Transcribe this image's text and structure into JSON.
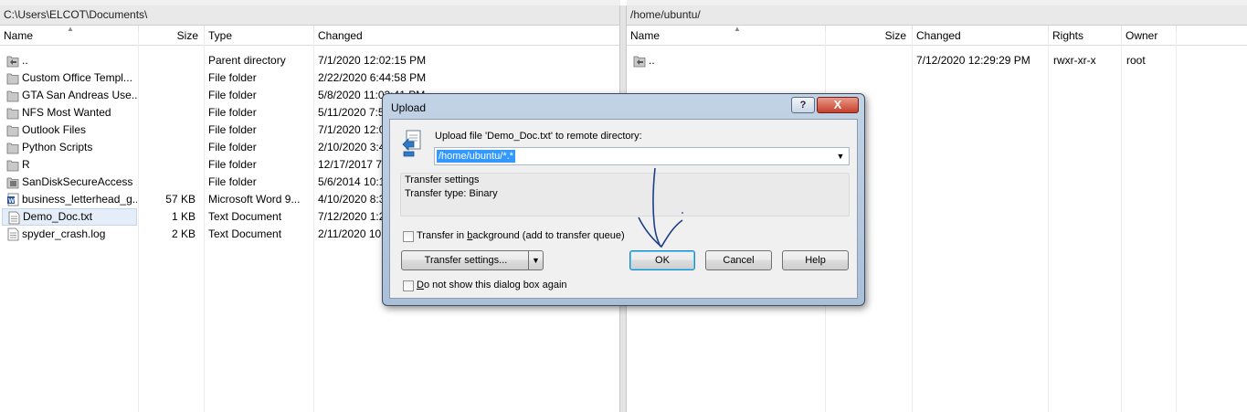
{
  "left_panel": {
    "path": "C:\\Users\\ELCOT\\Documents\\",
    "columns": {
      "name": "Name",
      "size": "Size",
      "type": "Type",
      "changed": "Changed"
    },
    "rows": [
      {
        "name": "..",
        "size": "",
        "type": "Parent directory",
        "changed": "7/1/2020  12:02:15 PM",
        "icon": "parent-folder-icon"
      },
      {
        "name": "Custom Office Templ...",
        "size": "",
        "type": "File folder",
        "changed": "2/22/2020  6:44:58 PM",
        "icon": "folder-icon"
      },
      {
        "name": "GTA San Andreas Use...",
        "size": "",
        "type": "File folder",
        "changed": "5/8/2020  11:03:41 PM",
        "icon": "folder-icon"
      },
      {
        "name": "NFS Most Wanted",
        "size": "",
        "type": "File folder",
        "changed": "5/11/2020  7:5",
        "icon": "folder-icon"
      },
      {
        "name": "Outlook Files",
        "size": "",
        "type": "File folder",
        "changed": "7/1/2020  12:0",
        "icon": "folder-icon"
      },
      {
        "name": "Python Scripts",
        "size": "",
        "type": "File folder",
        "changed": "2/10/2020  3:4",
        "icon": "folder-icon"
      },
      {
        "name": "R",
        "size": "",
        "type": "File folder",
        "changed": "12/17/2017  7",
        "icon": "folder-icon"
      },
      {
        "name": "SanDiskSecureAccess ...",
        "size": "",
        "type": "File folder",
        "changed": "5/6/2014  10:1",
        "icon": "sandisk-folder-icon"
      },
      {
        "name": "business_letterhead_g...",
        "size": "57 KB",
        "type": "Microsoft Word 9...",
        "changed": "4/10/2020  8:3",
        "icon": "word-document-icon"
      },
      {
        "name": "Demo_Doc.txt",
        "size": "1 KB",
        "type": "Text Document",
        "changed": "7/12/2020  1:2",
        "icon": "text-file-icon",
        "selected": true
      },
      {
        "name": "spyder_crash.log",
        "size": "2 KB",
        "type": "Text Document",
        "changed": "2/11/2020  10:",
        "icon": "text-file-icon"
      }
    ]
  },
  "right_panel": {
    "path": "/home/ubuntu/",
    "columns": {
      "name": "Name",
      "size": "Size",
      "changed": "Changed",
      "rights": "Rights",
      "owner": "Owner"
    },
    "rows": [
      {
        "name": "..",
        "size": "",
        "changed": "7/12/2020  12:29:29 PM",
        "rights": "rwxr-xr-x",
        "owner": "root",
        "icon": "parent-folder-icon"
      }
    ]
  },
  "dialog": {
    "title": "Upload",
    "help_glyph": "?",
    "close_glyph": "X",
    "prompt": "Upload file 'Demo_Doc.txt' to remote directory:",
    "target_value": "/home/ubuntu/*.*",
    "group_title": "Transfer settings",
    "transfer_type": "Transfer type: Binary",
    "background_prefix": "Transfer in ",
    "background_hotkey": "b",
    "background_suffix": "ackground (add to transfer queue)",
    "transfer_settings_btn": "Transfer settings...",
    "ok": "OK",
    "cancel": "Cancel",
    "help": "Help",
    "dont_show_hotkey": "D",
    "dont_show_suffix": "o not show this dialog box again",
    "colors": {
      "title_bar": "#b6c9df",
      "selection": "#3399ff",
      "close": "#c7402a"
    }
  }
}
